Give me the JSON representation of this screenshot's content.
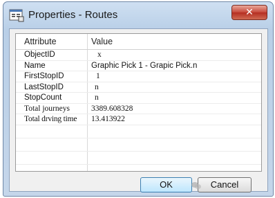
{
  "window": {
    "title": "Properties - Routes",
    "close_label": "✕"
  },
  "grid": {
    "headers": {
      "attribute": "Attribute",
      "value": "Value"
    },
    "rows": [
      {
        "attribute": "ObjectID",
        "value": "x"
      },
      {
        "attribute": "Name",
        "value": "Graphic Pick 1 - Grapic Pick.n"
      },
      {
        "attribute": "FirstStopID",
        "value": "1"
      },
      {
        "attribute": "LastStopID",
        "value": "n"
      },
      {
        "attribute": "StopCount",
        "value": "n"
      },
      {
        "attribute": "Total journeys",
        "value": "3389.608328"
      },
      {
        "attribute": "Total drving time",
        "value": "13.413922"
      }
    ]
  },
  "buttons": {
    "ok": "OK",
    "cancel": "Cancel"
  }
}
